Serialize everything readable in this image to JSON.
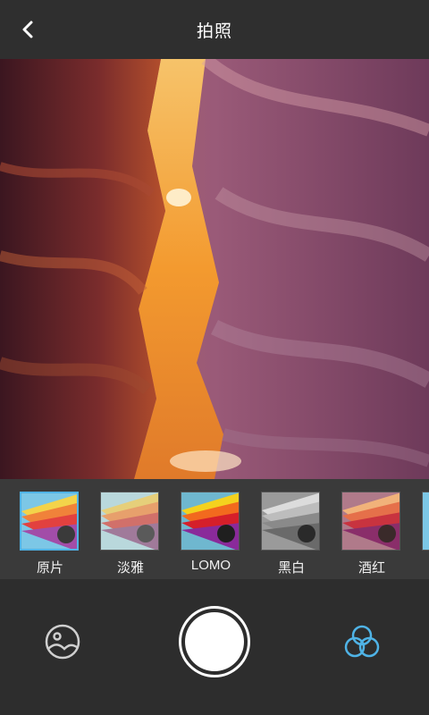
{
  "header": {
    "title": "拍照",
    "back_icon": "chevron-left-icon"
  },
  "preview": {
    "description_icon": "canyon-photo"
  },
  "filters": {
    "items": [
      {
        "label": "原片",
        "selected": true
      },
      {
        "label": "淡雅",
        "selected": false
      },
      {
        "label": "LOMO",
        "selected": false
      },
      {
        "label": "黑白",
        "selected": false
      },
      {
        "label": "酒红",
        "selected": false
      }
    ]
  },
  "bottom_bar": {
    "gallery_icon": "gallery-icon",
    "shutter_icon": "shutter-button",
    "filter_icon": "filter-circles-icon"
  },
  "colors": {
    "accent": "#4fb3e6",
    "background": "#2d2d2d",
    "strip": "#3a3a3a"
  }
}
